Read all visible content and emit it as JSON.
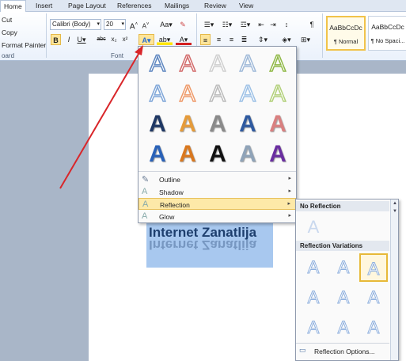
{
  "tabs": [
    "Home",
    "Insert",
    "Page Layout",
    "References",
    "Mailings",
    "Review",
    "View"
  ],
  "clipboard": {
    "cut": "Cut",
    "copy": "Copy",
    "format_painter": "Format Painter",
    "group": "oard"
  },
  "font": {
    "name": "Calibri (Body)",
    "size": "20",
    "group": "Font"
  },
  "styles": [
    {
      "preview": "AaBbCcDc",
      "name": "¶ Normal"
    },
    {
      "preview": "AaBbCcDc",
      "name": "¶ No Spaci..."
    }
  ],
  "colors": {
    "accent": "#f1c34a",
    "arrow": "#d9262a",
    "text_blue": "#1e3f6e"
  },
  "gallery": {
    "glyph": "A",
    "rows": [
      [
        "#5f87c0",
        "#d26b6b",
        "#cfcfcf",
        "#9fb9d8",
        "#8fb846"
      ],
      [
        "#7fa6d8",
        "#ee9a6a",
        "#bbbbbb",
        "#9dc1e6",
        "#b2d07a"
      ],
      [
        "#1f3864",
        "#e59b3a",
        "#8a8a8a",
        "#2f5aa0",
        "#d98080"
      ],
      [
        "#2a62b8",
        "#d9781f",
        "#111111",
        "#8fa3b8",
        "#6a2fa0"
      ]
    ]
  },
  "menu": [
    {
      "label": "Outline",
      "icon": "pencil-icon"
    },
    {
      "label": "Shadow",
      "icon": "shadow-icon"
    },
    {
      "label": "Reflection",
      "icon": "reflection-icon",
      "highlighted": true
    },
    {
      "label": "Glow",
      "icon": "glow-icon"
    }
  ],
  "document_text": "Internet Zanatlija",
  "reflection_submenu": {
    "no_reflection": "No Reflection",
    "variations": "Reflection Variations",
    "options": "Reflection Options...",
    "selected_index": 2
  }
}
